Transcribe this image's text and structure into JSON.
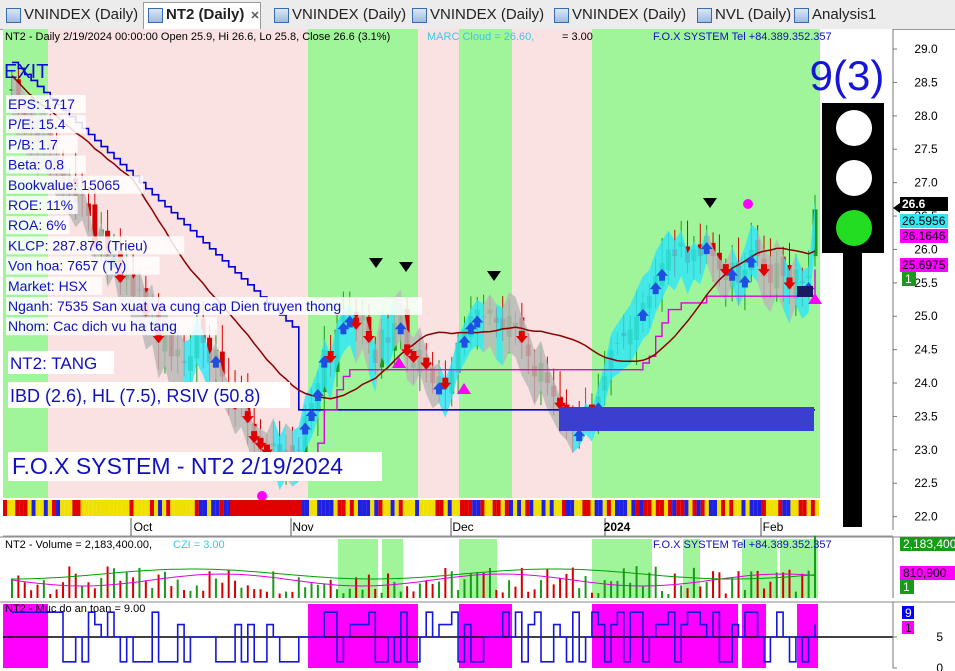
{
  "tabs": [
    {
      "label": "VNINDEX (Daily)",
      "active": false
    },
    {
      "label": "NT2 (Daily)",
      "active": true
    },
    {
      "label": "VNINDEX (Daily)",
      "active": false
    },
    {
      "label": "VNINDEX (Daily)",
      "active": false
    },
    {
      "label": "VNINDEX (Daily)",
      "active": false
    },
    {
      "label": "NVL (Daily)",
      "active": false
    },
    {
      "label": "Analysis1",
      "active": false
    }
  ],
  "header": {
    "main": "NT2 - Daily 2/19/2024 00:00:00 Open 25.9, Hi 26.6, Lo 25.8, Close 26.6 (3.1%)",
    "marc": "MARC Cloud = 26.60,",
    "eq": "= 3.00",
    "fox": "F.O.X SYSTEM Tel +84.389.352.357"
  },
  "overlay": {
    "exit": "EXIT",
    "fundamentals": [
      "EPS: 1717",
      "P/E: 15.4",
      "P/B: 1.7",
      "Beta: 0.8",
      "Bookvalue: 15065",
      "ROE: 11%",
      "ROA: 6%",
      "KLCP: 287.876 (Trieu)",
      "Von hoa: 7657 (Ty)",
      "Market: HSX",
      "Nganh: 7535 San xuat va cung cap Dien truyen thong",
      "Nhom: Cac dich vu ha tang"
    ],
    "trend": "NT2: TANG",
    "ibd": "IBD (2.6), HL (7.5), RSIV (50.8)",
    "banner": "F.O.X SYSTEM - NT2 2/19/2024",
    "score": "9(3)"
  },
  "colors": {
    "up": "#1a9a1a",
    "down": "#d40000",
    "bg_green": "#a0f59a",
    "bg_pink": "#fbe2e2",
    "cyan": "#33e6f5",
    "magenta": "#ff00ff",
    "blue": "#0000ff"
  },
  "chart_data": [
    {
      "type": "candlestick",
      "title": "NT2 - Daily",
      "xlabels": [
        "Oct",
        "Nov",
        "Dec",
        "2024",
        "Feb"
      ],
      "ylim": [
        21.8,
        29.3
      ],
      "yticks": [
        22.0,
        22.5,
        23.0,
        23.5,
        24.0,
        24.5,
        25.0,
        25.5,
        26.0,
        26.5,
        27.0,
        27.5,
        28.0,
        28.5,
        29.0
      ],
      "price_labels": [
        {
          "text": "26.6",
          "bg": "#000000",
          "fg": "#ffffff"
        },
        {
          "text": "26.5956",
          "bg": "#33e6f5",
          "fg": "#000000"
        },
        {
          "text": "26.1646",
          "bg": "#ff00ff",
          "fg": "#000000"
        },
        {
          "text": "25.6975",
          "bg": "#ff00ff",
          "fg": "#000000"
        },
        {
          "text": "1",
          "bg": "#1a9a1a",
          "fg": "#ffffff"
        }
      ],
      "close": [
        28.4,
        28.2,
        28.0,
        27.8,
        27.6,
        27.7,
        27.5,
        27.2,
        27.0,
        26.9,
        26.7,
        26.8,
        26.5,
        26.0,
        26.3,
        25.8,
        26.0,
        25.5,
        25.7,
        25.3,
        25.4,
        25.0,
        25.1,
        24.6,
        24.8,
        24.4,
        24.5,
        24.3,
        24.4,
        24.8,
        24.6,
        24.3,
        24.5,
        24.1,
        23.9,
        23.6,
        23.7,
        23.4,
        23.1,
        23.0,
        22.9,
        23.1,
        22.8,
        23.0,
        22.9,
        23.0,
        23.5,
        23.7,
        24.0,
        24.5,
        24.3,
        24.8,
        25.0,
        25.1,
        24.8,
        25.0,
        24.6,
        24.3,
        24.8,
        24.6,
        24.9,
        25.0,
        24.4,
        24.3,
        24.5,
        24.2,
        24.0,
        24.1,
        23.9,
        24.2,
        24.6,
        24.8,
        25.0,
        25.1,
        25.0,
        25.1,
        24.9,
        24.8,
        25.0,
        24.9,
        24.6,
        24.4,
        24.1,
        24.3,
        24.0,
        23.8,
        23.6,
        23.5,
        23.3,
        23.4,
        23.6,
        23.5,
        23.8,
        24.1,
        24.5,
        24.6,
        24.7,
        24.8,
        25.0,
        25.2,
        25.3,
        25.6,
        25.8,
        26.0,
        25.9,
        26.1,
        25.8,
        26.0,
        25.9,
        26.2,
        25.9,
        25.7,
        25.6,
        25.8,
        25.5,
        25.7,
        26.0,
        25.9,
        25.6,
        25.5,
        25.8,
        25.6,
        25.4,
        25.7,
        25.5,
        25.6,
        26.6
      ]
    },
    {
      "type": "bar",
      "title": "NT2 - Volume = 2,183,400.00,",
      "czi": "CZI = 3.00",
      "fox": "F.O.X SYSTEM Tel +84.389.352.357",
      "last_value": 2183400,
      "labels": [
        {
          "text": "2,183,400",
          "bg": "#1a9a1a",
          "fg": "#ffffff"
        },
        {
          "text": "810,900",
          "bg": "#ff00ff",
          "fg": "#000000"
        },
        {
          "text": "1",
          "bg": "#1a9a1a",
          "fg": "#ffffff"
        }
      ]
    },
    {
      "type": "line",
      "title": "NT2 - Muc do an toan = 9.00",
      "yticks": [
        0,
        5
      ],
      "value": 9,
      "labels": [
        {
          "text": "9",
          "bg": "#0000ff",
          "fg": "#ffffff"
        },
        {
          "text": "1",
          "bg": "#ff00ff",
          "fg": "#000000"
        }
      ]
    }
  ]
}
